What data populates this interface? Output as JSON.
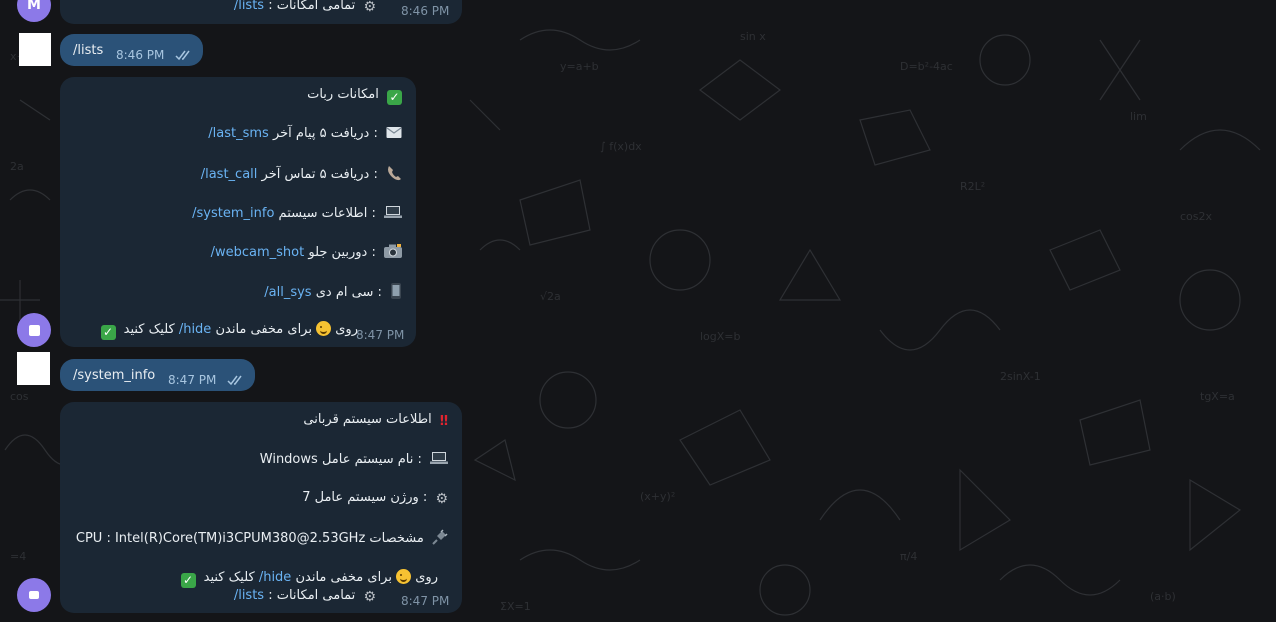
{
  "chat": {
    "top_partial": {
      "avatar_letter": "M",
      "line": {
        "cmd": "/lists",
        "text": ": تمامی امکانات"
      },
      "time": "8:46 PM"
    },
    "out1": {
      "text": "/lists",
      "time": "8:46 PM"
    },
    "menu": {
      "title": "امکانات ربات",
      "items": [
        {
          "icon": "envelope-icon",
          "text": "دریافت ۵ پیام آخر : ",
          "cmd": "/last_sms"
        },
        {
          "icon": "phone-icon",
          "text": "دریافت ۵ تماس آخر : ",
          "cmd": "/last_call"
        },
        {
          "icon": "laptop-icon",
          "text": "اطلاعات سیستم : ",
          "cmd": "/system_info"
        },
        {
          "icon": "camera-icon",
          "text": "دوربین جلو : ",
          "cmd": "/webcam_shot"
        },
        {
          "icon": "mobile-icon",
          "text": "سی ام دی : ",
          "cmd": "/all_sys"
        }
      ],
      "hide_line": {
        "before": "برای مخفی ماندن",
        "mid": " روی ",
        "cmd": "/hide",
        "after": " کلیک کنید"
      },
      "time": "8:47 PM"
    },
    "out2": {
      "text": "/system_info",
      "time": "8:47 PM"
    },
    "sysinfo": {
      "title": "اطلاعات سیستم قربانی",
      "items": [
        {
          "icon": "laptop-icon",
          "label": "نام سیستم عامل : ",
          "value": "Windows"
        },
        {
          "icon": "gear-icon",
          "label": "ورژن سیستم عامل : ",
          "value": "7"
        },
        {
          "icon": "plug-icon",
          "label": "مشخصات ",
          "value": "CPU :  Intel(R)Core(TM)i3CPUM380@2.53GHz"
        }
      ],
      "hide_line": {
        "before": "برای مخفی ماندن",
        "mid": " روی ",
        "cmd": "/hide",
        "after": " کلیک کنید"
      },
      "lists_line": {
        "cmd": "/lists",
        "text": ": تمامی امکانات"
      },
      "time": "8:47 PM"
    }
  },
  "colors": {
    "incoming": "#1b2734",
    "outgoing": "#2b5278",
    "link": "#6ab3f3",
    "avatar": "#8c79e8"
  }
}
